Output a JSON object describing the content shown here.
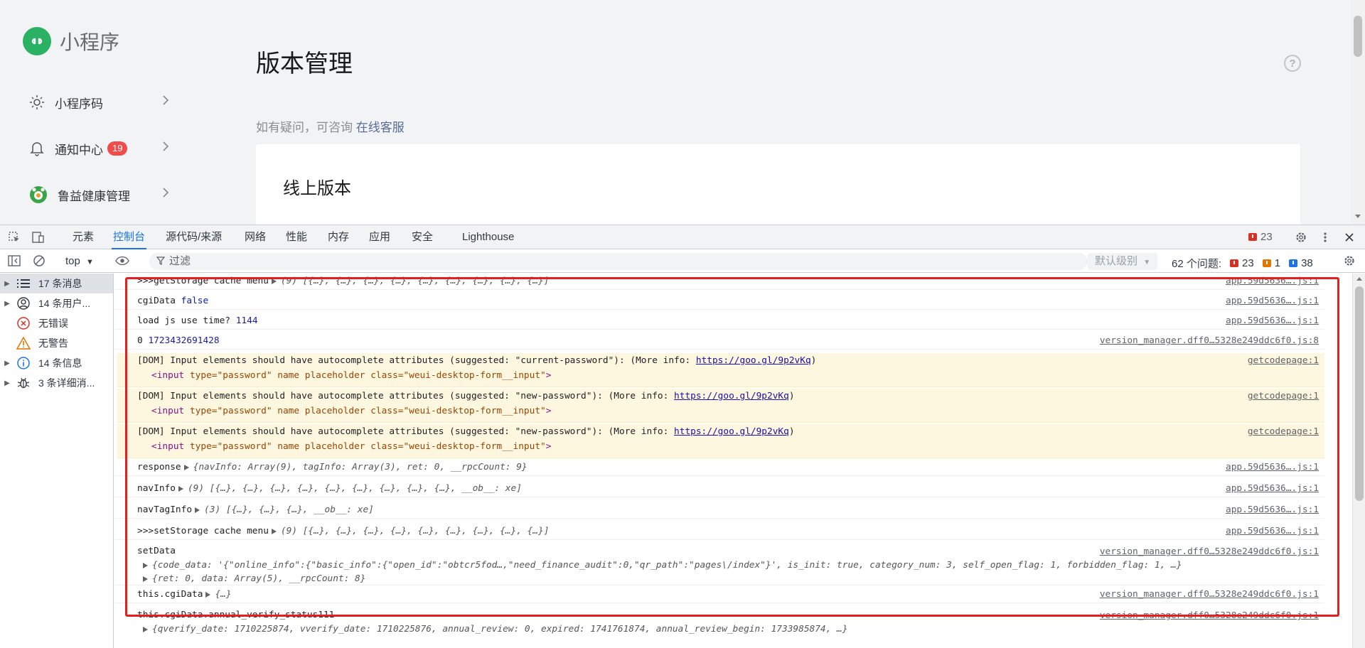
{
  "app": {
    "logo_text": "小程序",
    "nav": [
      {
        "label": "小程序码",
        "icon": "sun-icon"
      },
      {
        "label": "通知中心",
        "badge": "19",
        "icon": "bell-icon"
      },
      {
        "label": "鲁益健康管理",
        "icon": "mini-program-avatar-icon"
      }
    ],
    "page_title": "版本管理",
    "consult_prefix": "如有疑问，可咨询",
    "consult_link": "在线客服",
    "card_title": "线上版本",
    "help_icon_text": "?"
  },
  "devtools": {
    "tabs": [
      "元素",
      "控制台",
      "源代码/来源",
      "网络",
      "性能",
      "内存",
      "应用",
      "安全",
      "Lighthouse"
    ],
    "active_tab": "控制台",
    "error_count": "23",
    "context": "top",
    "filter_placeholder": "过滤",
    "levels_label": "默认级别",
    "issues_label": "62 个问题:",
    "issues_errors": "23",
    "issues_warnings": "1",
    "issues_info": "38",
    "sidebar": [
      {
        "label": "17 条消息",
        "icon": "list-icon",
        "expandable": true,
        "selected": true
      },
      {
        "label": "14 条用户...",
        "icon": "user-icon",
        "expandable": true
      },
      {
        "label": "无错误",
        "icon": "error-icon",
        "expandable": false
      },
      {
        "label": "无警告",
        "icon": "warning-icon",
        "expandable": false
      },
      {
        "label": "14 条信息",
        "icon": "info-icon",
        "expandable": true
      },
      {
        "label": "3 条详细消...",
        "icon": "bug-icon",
        "expandable": true
      }
    ],
    "logs": [
      {
        "prefix": ">>>getStorage cache menu",
        "preview": "(9)  [{…}, {…}, {…}, {…}, {…}, {…}, {…}, {…}, {…}]",
        "source": "app.59d5636….js:1"
      },
      {
        "prefix": "cgiData",
        "value": "false",
        "source": "app.59d5636….js:1"
      },
      {
        "prefix": "load js use time?",
        "value": "1144",
        "source": "app.59d5636….js:1"
      },
      {
        "prefix": "0",
        "value": "1723432691428",
        "source": "version_manager.dff0…5328e249ddc6f0.js:8"
      },
      {
        "message": "[DOM] Input elements should have autocomplete attributes (suggested: \"current-password\"): (More info: ",
        "link": "https://goo.gl/9p2vKq",
        "close": ")",
        "html_tag": "input",
        "html_attrs": "type=\"password\" name placeholder class=\"weui-desktop-form__input\"",
        "source": "getcodepage:1"
      },
      {
        "message": "[DOM] Input elements should have autocomplete attributes (suggested: \"new-password\"): (More info: ",
        "link": "https://goo.gl/9p2vKq",
        "close": ")",
        "html_tag": "input",
        "html_attrs": "type=\"password\" name placeholder class=\"weui-desktop-form__input\"",
        "source": "getcodepage:1"
      },
      {
        "message": "[DOM] Input elements should have autocomplete attributes (suggested: \"new-password\"): (More info: ",
        "link": "https://goo.gl/9p2vKq",
        "close": ")",
        "html_tag": "input",
        "html_attrs": "type=\"password\" name placeholder class=\"weui-desktop-form__input\"",
        "source": "getcodepage:1"
      },
      {
        "prefix": "response",
        "preview": "{navInfo: Array(9), tagInfo: Array(3), ret: 0, __rpcCount: 9}",
        "source": "app.59d5636….js:1"
      },
      {
        "prefix": "navInfo",
        "preview": "(9)  [{…}, {…}, {…}, {…}, {…}, {…}, {…}, {…}, {…}, __ob__: xe]",
        "source": "app.59d5636….js:1"
      },
      {
        "prefix": "navTagInfo",
        "preview": "(3)  [{…}, {…}, {…}, __ob__: xe]",
        "source": "app.59d5636….js:1"
      },
      {
        "prefix": ">>>setStorage cache menu",
        "preview": "(9)  [{…}, {…}, {…}, {…}, {…}, {…}, {…}, {…}, {…}]",
        "source": "app.59d5636….js:1"
      },
      {
        "prefix": "setData",
        "line2": "{code_data: '{\"online_info\":{\"basic_info\":{\"open_id\":\"obtcr5fod…,\"need_finance_audit\":0,\"qr_path\":\"pages\\/index\"}', is_init: true, category_num: 3, self_open_flag: 1, forbidden_flag: 1,  …}",
        "line3": "{ret: 0, data: Array(5), __rpcCount: 8}",
        "source": "version_manager.dff0…5328e249ddc6f0.js:1"
      },
      {
        "prefix": "this.cgiData",
        "preview": "{…}",
        "source": "version_manager.dff0…5328e249ddc6f0.js:1"
      },
      {
        "prefix": "this.cgiData.annual_verify_status111",
        "line2": "{qverify_date: 1710225874, vverify_date: 1710225876, annual_review: 0, expired: 1741761874, annual_review_begin: 1733985874,  …}",
        "source": "version_manager.dff0…5328e249ddc6f0.js:1"
      }
    ]
  }
}
